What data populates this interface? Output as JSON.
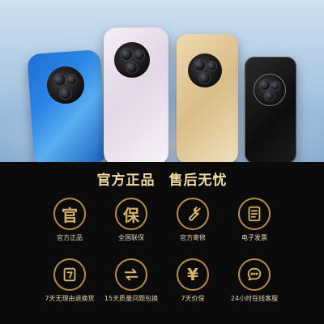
{
  "slogan": {
    "left": "官方正品",
    "right": "售后无忧"
  },
  "features": [
    {
      "glyph": "官",
      "icon": "guan-character-icon",
      "label": "官方正品"
    },
    {
      "glyph": "保",
      "icon": "bao-character-icon",
      "label": "全国联保"
    },
    {
      "glyph": "",
      "icon": "wrench-icon",
      "label": "官方寄修"
    },
    {
      "glyph": "",
      "icon": "invoice-icon",
      "label": "电子发票"
    },
    {
      "glyph": "7",
      "icon": "seven-day-return-icon",
      "label": "7天无理由退换货"
    },
    {
      "glyph": "",
      "icon": "exchange-arrows-icon",
      "label": "15天质量问题包换"
    },
    {
      "glyph": "¥",
      "icon": "price-protect-yen-icon",
      "label": "7天价保"
    },
    {
      "glyph": "",
      "icon": "chat-bubble-icon",
      "label": "24小时在线客服"
    }
  ],
  "colors": {
    "gold": "#b78b43",
    "gold_text": "#f2dca4",
    "background": "#0b0b0b"
  }
}
